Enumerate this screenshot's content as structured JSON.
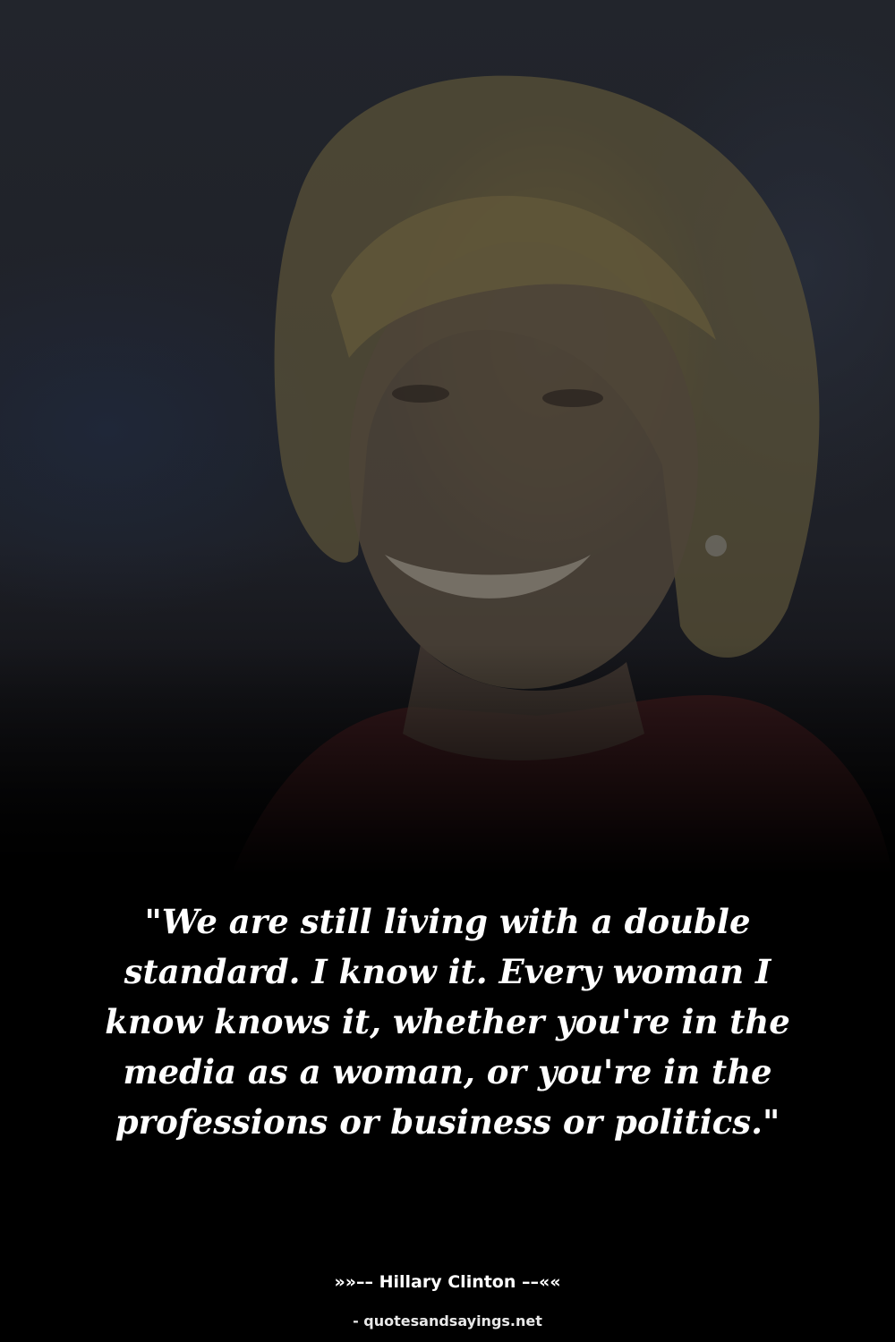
{
  "quote": {
    "text": "\"We are still living with a double standard. I know it. Every woman I know knows it, whether you're in the media as a woman, or you're in the professions or business or politics.\""
  },
  "attribution": {
    "author_line": "»»–– Hillary Clinton ––««"
  },
  "watermark": {
    "text": "- quotesandsayings.net"
  },
  "colors": {
    "background": "#000000",
    "text": "#ffffff"
  }
}
